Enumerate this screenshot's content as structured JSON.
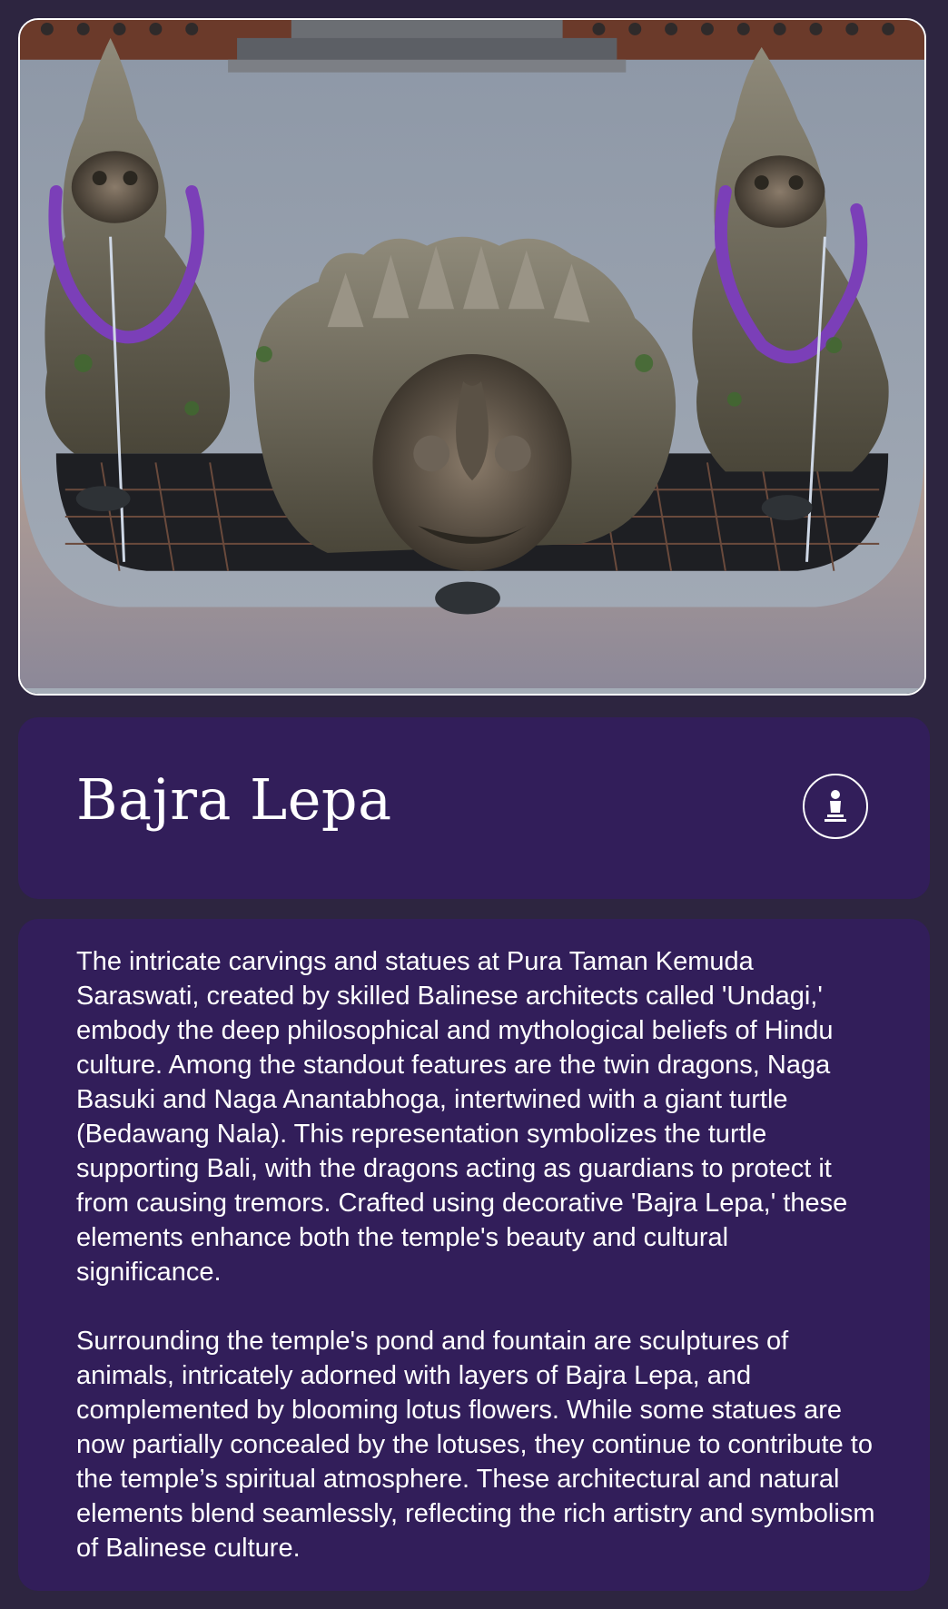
{
  "hero": {
    "image_alt": "Stone statues spouting water into the temple pond, adorned with purple garlands"
  },
  "header": {
    "title": "Bajra Lepa",
    "icon": "statue-icon"
  },
  "description": {
    "paragraphs": [
      "The intricate carvings and statues at Pura Taman Kemuda Saraswati, created by skilled Balinese architects called 'Undagi,' embody the deep philosophical and mythological beliefs of Hindu culture. Among the standout features are the twin dragons, Naga Basuki and Naga Anantabhoga, intertwined with a giant turtle (Bedawang Nala). This representation symbolizes the turtle supporting Bali, with the dragons acting as guardians to protect it from causing tremors. Crafted using decorative 'Bajra Lepa,' these elements enhance both the temple's beauty and cultural significance.",
      "Surrounding the temple's pond and fountain are sculptures of animals, intricately adorned with layers of Bajra Lepa, and complemented by blooming lotus flowers. While some statues are now partially concealed by the lotuses, they continue to contribute to the temple’s spiritual atmosphere. These architectural and natural elements blend seamlessly, reflecting the rich artistry and symbolism of Balinese culture."
    ]
  },
  "colors": {
    "page_background": "#2d2540",
    "card_background": "#321e5a",
    "text": "#ffffff",
    "garland": "#7b3fb8"
  }
}
